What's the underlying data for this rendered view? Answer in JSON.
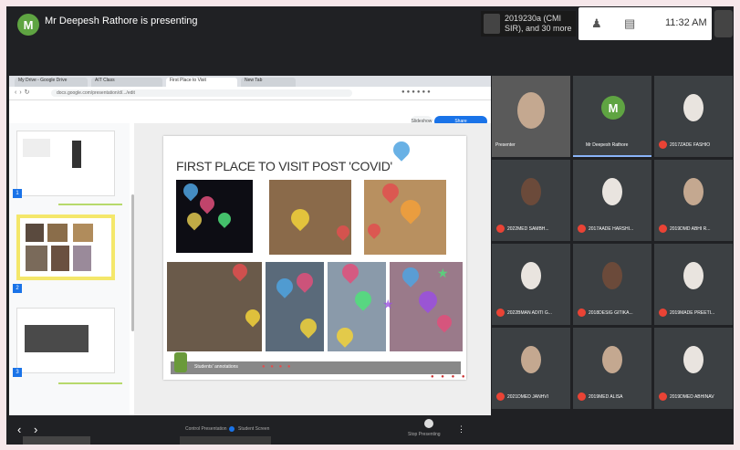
{
  "presenter_bar": {
    "presenter_initial": "M",
    "presenting_text": "Mr Deepesh Rathore is presenting",
    "others_text": "2019230a (CMI SIR), and 30 more",
    "time": "11:32 AM"
  },
  "colors": {
    "background": "#f6e7ea",
    "meet_dark": "#202124",
    "tile": "#3c4043",
    "presenter_green": "#5fa442",
    "accent_blue": "#1a73e8",
    "mic_red": "#ea4335",
    "selected_slide": "#f4e76a"
  },
  "browser": {
    "tabs": [
      "My Drive - Google Drive",
      "AIT Class",
      "First Place to Visit",
      "New Tab"
    ],
    "url": "docs.google.com/presentation/d/.../edit",
    "slideshow_button": "Slideshow",
    "present_button": "Share"
  },
  "slide": {
    "title": "FIRST PLACE TO VISIT POST 'COVID'",
    "bottom_text": "Students' annotations"
  },
  "slide_panel": {
    "slide_numbers": [
      "1",
      "2",
      "3"
    ]
  },
  "bottom_bar": {
    "label_left": "Control Presentation",
    "label_mid": "Student Screen",
    "label_right": "Stop Presenting",
    "prev_icon": "chevron-left-icon",
    "next_icon": "chevron-right-icon"
  },
  "participants": [
    {
      "name": "Presenter",
      "kind": "video"
    },
    {
      "name": "Mr Deepesh Rathore",
      "kind": "avatar",
      "initial": "M"
    },
    {
      "name": "2017ZADE FASHIO",
      "kind": "video"
    },
    {
      "name": "2022MED SAMBH...",
      "kind": "video"
    },
    {
      "name": "2017AADE HARSHI...",
      "kind": "video"
    },
    {
      "name": "2019DMD ABHI R...",
      "kind": "video"
    },
    {
      "name": "2022BMAN ADITI G...",
      "kind": "video"
    },
    {
      "name": "2018DESIG GITIKA...",
      "kind": "video"
    },
    {
      "name": "2019MADE PREETI...",
      "kind": "video"
    },
    {
      "name": "2021DMED JANHVI",
      "kind": "video"
    },
    {
      "name": "2019MED ALISA",
      "kind": "video"
    },
    {
      "name": "2019DMED ABHINAV",
      "kind": "video"
    }
  ]
}
